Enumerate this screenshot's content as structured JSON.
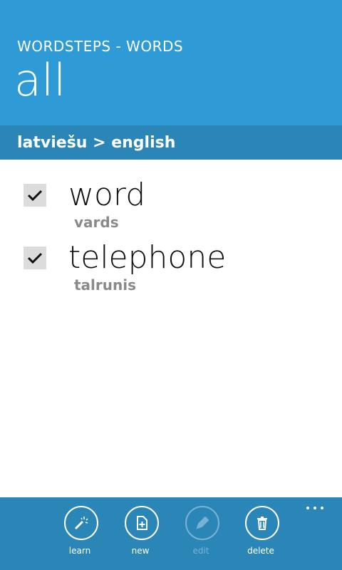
{
  "header": {
    "app_title": "WORDSTEPS - WORDS",
    "page_title": "all",
    "lang_pair": "latviešu > english"
  },
  "words": [
    {
      "word": "word",
      "translation": "vards",
      "checked": true
    },
    {
      "word": "telephone",
      "translation": "talrunis",
      "checked": true
    }
  ],
  "appbar": {
    "buttons": [
      {
        "label": "learn",
        "icon": "magic-wand-icon",
        "enabled": true
      },
      {
        "label": "new",
        "icon": "new-document-icon",
        "enabled": true
      },
      {
        "label": "edit",
        "icon": "pencil-icon",
        "enabled": false
      },
      {
        "label": "delete",
        "icon": "trash-icon",
        "enabled": true
      }
    ],
    "more_icon": "ellipsis-icon"
  },
  "colors": {
    "header_bg": "#2f9bd6",
    "subheader_bg": "#2b86b8",
    "appbar_bg": "#2b86b8",
    "translation_text": "#8a8a8a"
  }
}
